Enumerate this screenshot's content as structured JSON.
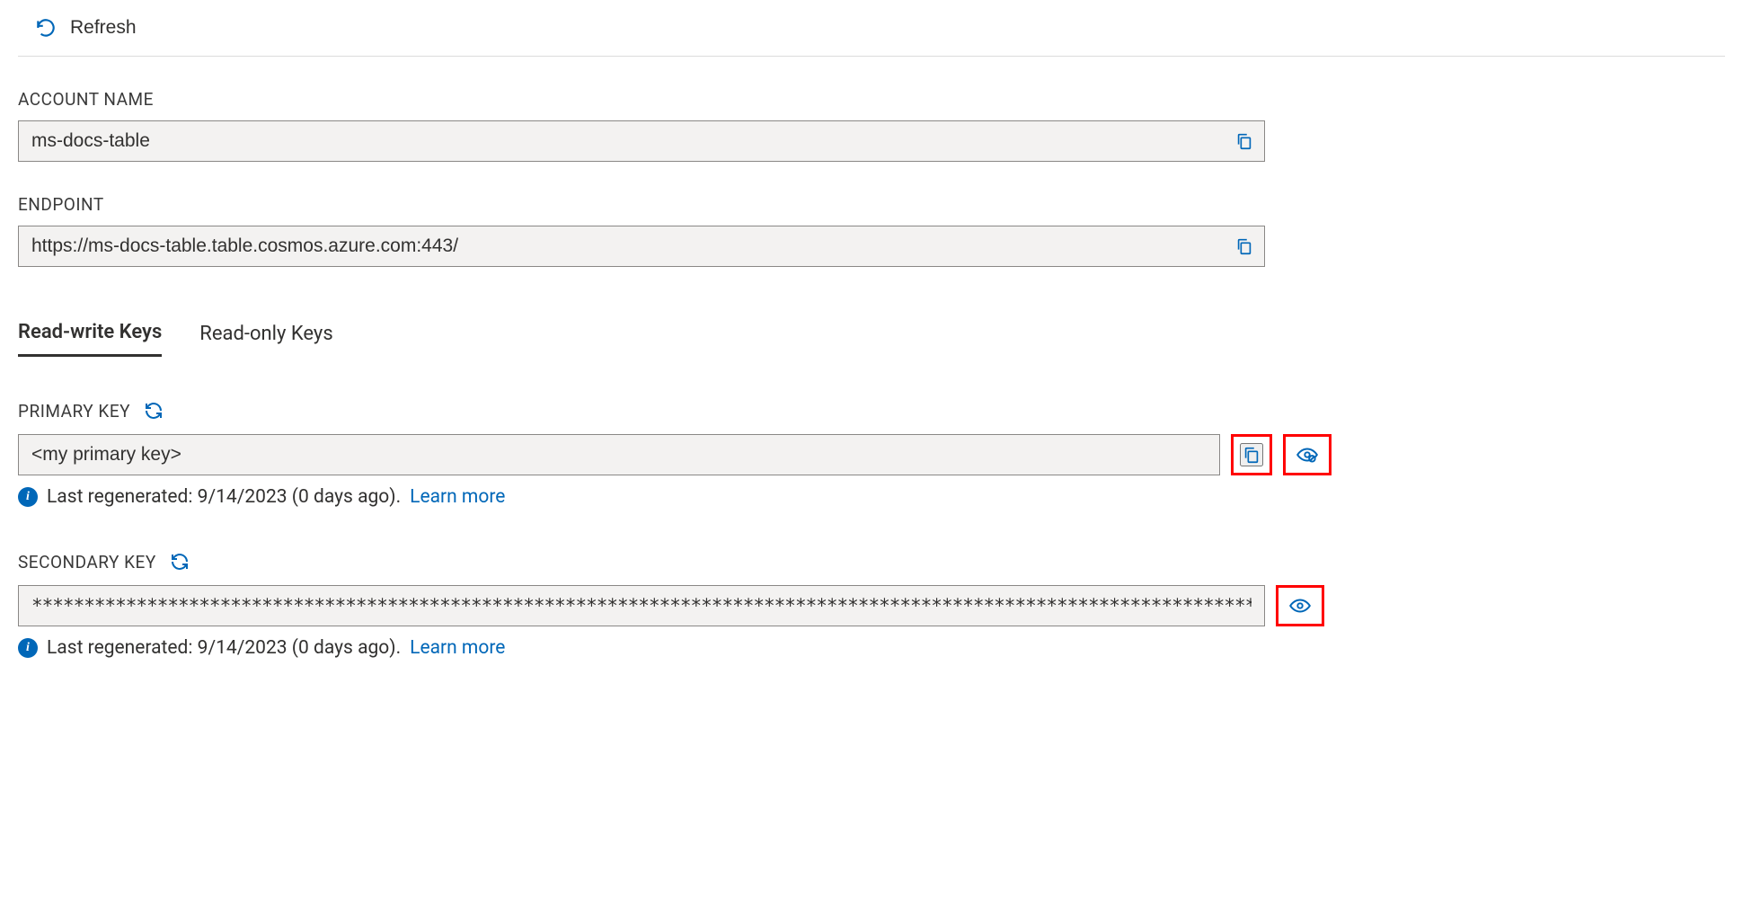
{
  "toolbar": {
    "refresh_label": "Refresh"
  },
  "fields": {
    "account_name": {
      "label": "ACCOUNT NAME",
      "value": "ms-docs-table"
    },
    "endpoint": {
      "label": "ENDPOINT",
      "value": "https://ms-docs-table.table.cosmos.azure.com:443/"
    }
  },
  "tabs": {
    "read_write": "Read-write Keys",
    "read_only": "Read-only Keys"
  },
  "primary_key": {
    "label": "PRIMARY KEY",
    "value": "<my primary key>",
    "info_prefix": "Last regenerated: 9/14/2023 (0 days ago).",
    "learn_more": "Learn more"
  },
  "secondary_key": {
    "label": "SECONDARY KEY",
    "value": "*****************************************************************************************************************************************************************************************",
    "info_prefix": "Last regenerated: 9/14/2023 (0 days ago).",
    "learn_more": "Learn more"
  },
  "colors": {
    "accent": "#0067b8",
    "highlight": "#ff0000"
  }
}
